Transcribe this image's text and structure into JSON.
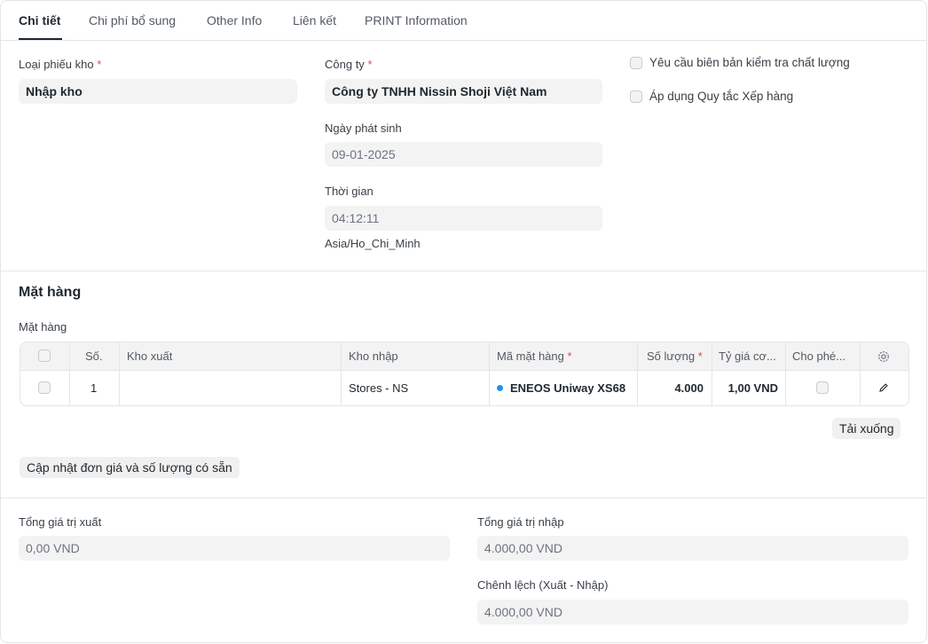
{
  "tabs": [
    "Chi tiết",
    "Chi phí bổ sung",
    "Other Info",
    "Liên kết",
    "PRINT Information"
  ],
  "details": {
    "entry_type_label": "Loại phiếu kho",
    "entry_type_value": "Nhập kho",
    "company_label": "Công ty",
    "company_value": "Công ty TNHH Nissin Shoji Việt Nam",
    "posting_date_label": "Ngày phát sinh",
    "posting_date_value": "09-01-2025",
    "posting_time_label": "Thời gian",
    "posting_time_value": "04:12:11",
    "timezone": "Asia/Ho_Chi_Minh",
    "inspection_required_label": "Yêu cầu biên bản kiểm tra chất lượng",
    "apply_putaway_label": "Áp dụng Quy tắc Xếp hàng",
    "required_mark": "*"
  },
  "items_section": {
    "title": "Mặt hàng",
    "table_label": "Mặt hàng",
    "columns": [
      "Số.",
      "Kho xuất",
      "Kho nhập",
      "Mã mặt hàng",
      "Số lượng",
      "Tỷ giá cơ...",
      "Cho phé..."
    ],
    "rows": [
      {
        "no": "1",
        "source_warehouse": "",
        "target_warehouse": "Stores - NS",
        "item_code": "ENEOS Uniway XS68",
        "qty": "4.000",
        "rate": "1,00 VND"
      }
    ],
    "download_button": "Tải xuống",
    "update_rate_button": "Cập nhật đơn giá và số lượng có sẵn"
  },
  "totals": {
    "outgoing_label": "Tổng giá trị xuất",
    "outgoing_value": "0,00 VND",
    "incoming_label": "Tổng giá trị nhập",
    "incoming_value": "4.000,00 VND",
    "difference_label": "Chênh lệch (Xuất - Nhập)",
    "difference_value": "4.000,00 VND"
  },
  "colors": {
    "accent_dot": "#2490ef",
    "required": "#e24c4c"
  }
}
